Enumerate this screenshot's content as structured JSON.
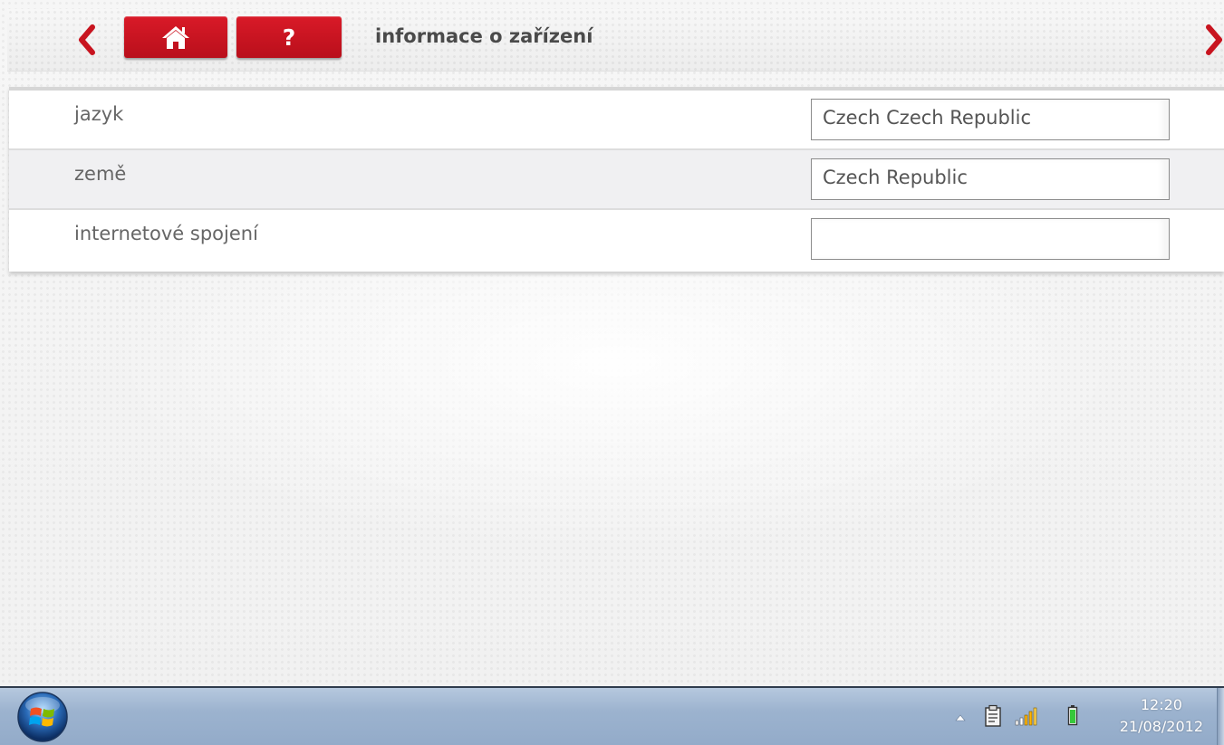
{
  "header": {
    "title": "informace o zařízení",
    "help_label": "?"
  },
  "rows": [
    {
      "label": "jazyk",
      "value": "Czech Czech Republic"
    },
    {
      "label": "země",
      "value": "Czech Republic"
    },
    {
      "label": "internetové spojení",
      "value": ""
    }
  ],
  "taskbar": {
    "time": "12:20",
    "date": "21/08/2012"
  },
  "colors": {
    "accent_red": "#c8141f",
    "taskbar_blue": "#9cb3cf"
  },
  "icons": [
    "back-chevron-icon",
    "home-icon",
    "help-icon",
    "forward-chevron-icon",
    "windows-start-icon",
    "tray-expand-icon",
    "clipboard-icon",
    "signal-bars-icon",
    "battery-icon"
  ]
}
